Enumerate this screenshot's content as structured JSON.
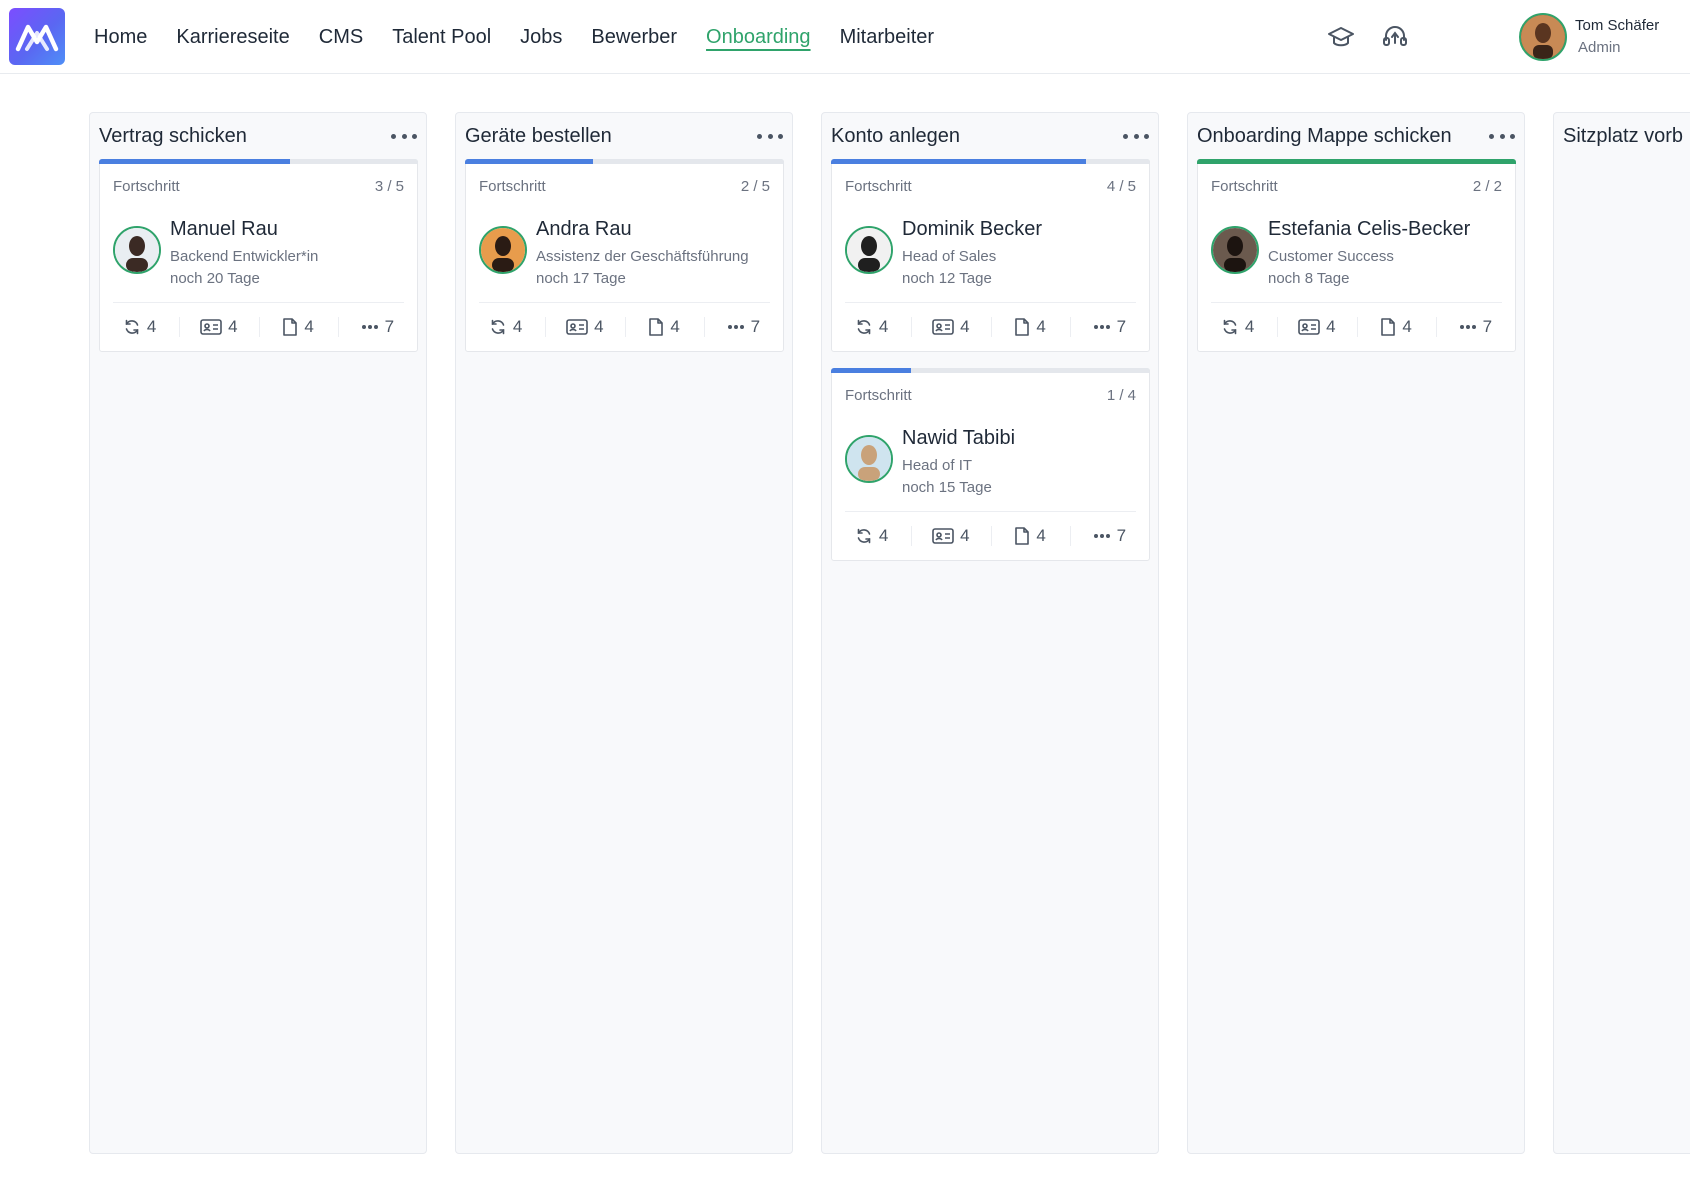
{
  "nav": {
    "items": [
      "Home",
      "Karriereseite",
      "CMS",
      "Talent Pool",
      "Jobs",
      "Bewerber",
      "Onboarding",
      "Mitarbeiter"
    ],
    "active": "Onboarding"
  },
  "header": {
    "icons": [
      "graduation-cap-icon",
      "headset-icon"
    ],
    "user": {
      "name": "Tom Schäfer",
      "role": "Admin"
    }
  },
  "colors": {
    "accent_green": "#2fa36b",
    "progress_blue": "#4a7fe0",
    "logo_gradient": [
      "#7c4dff",
      "#4f8ff7"
    ]
  },
  "progress_label": "Fortschritt",
  "columns": [
    {
      "title": "Vertrag schicken",
      "cards": [
        {
          "progress_text": "3 / 5",
          "progress": 0.6,
          "name": "Manuel Rau",
          "role": "Backend Entwickler*in",
          "days": "noch 20 Tage",
          "stats": {
            "tasks": "4",
            "ids": "4",
            "docs": "4",
            "more": "7"
          }
        }
      ]
    },
    {
      "title": "Geräte bestellen",
      "cards": [
        {
          "progress_text": "2 / 5",
          "progress": 0.4,
          "name": "Andra Rau",
          "role": "Assistenz der Geschäftsführung",
          "days": "noch 17 Tage",
          "stats": {
            "tasks": "4",
            "ids": "4",
            "docs": "4",
            "more": "7"
          }
        }
      ]
    },
    {
      "title": "Konto anlegen",
      "cards": [
        {
          "progress_text": "4 / 5",
          "progress": 0.8,
          "name": "Dominik Becker",
          "role": "Head of Sales",
          "days": "noch 12 Tage",
          "stats": {
            "tasks": "4",
            "ids": "4",
            "docs": "4",
            "more": "7"
          }
        },
        {
          "progress_text": "1 / 4",
          "progress": 0.25,
          "name": "Nawid Tabibi",
          "role": "Head of IT",
          "days": "noch 15 Tage",
          "stats": {
            "tasks": "4",
            "ids": "4",
            "docs": "4",
            "more": "7"
          }
        }
      ]
    },
    {
      "title": "Onboarding Mappe schicken",
      "cards": [
        {
          "progress_text": "2 / 2",
          "progress": 1.0,
          "name": "Estefania Celis-Becker",
          "role": "Customer Success",
          "days": "noch 8 Tage",
          "stats": {
            "tasks": "4",
            "ids": "4",
            "docs": "4",
            "more": "7"
          }
        }
      ]
    },
    {
      "title": "Sitzplatz vorb",
      "cards": []
    }
  ]
}
